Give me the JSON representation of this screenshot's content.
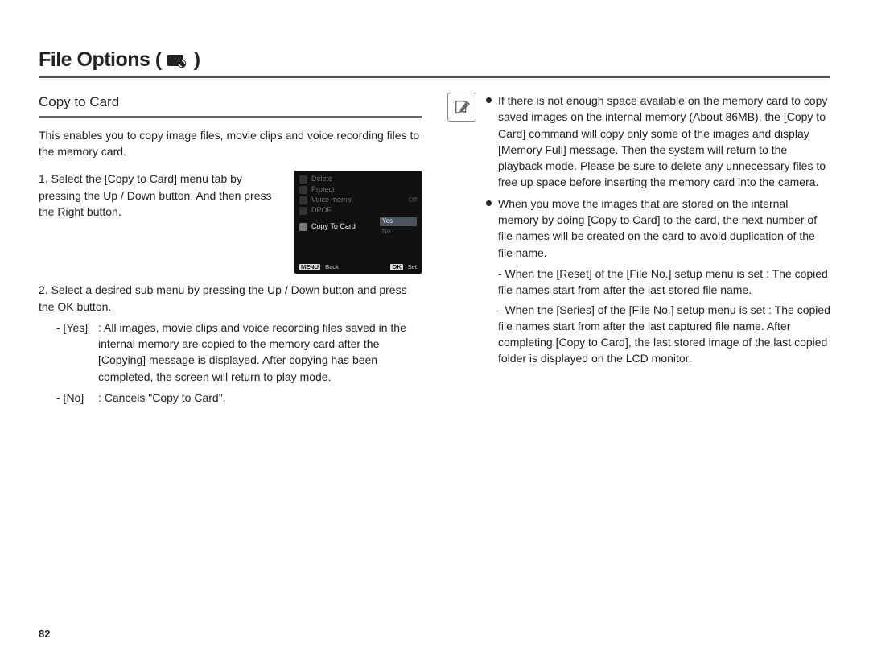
{
  "page_number": "82",
  "title": {
    "text": "File Options",
    "open_paren": "(",
    "close_paren": ")"
  },
  "left": {
    "subhead": "Copy to Card",
    "intro": "This enables you to copy image files, movie clips and voice recording files to the memory card.",
    "steps": [
      "1. Select the [Copy to Card] menu tab by pressing the Up / Down button. And then press the Right button.",
      "2. Select a desired sub menu by pressing the Up / Down button and press the OK button."
    ],
    "sub": [
      {
        "k": "- [Yes]",
        "v": ": All images, movie clips and voice recording files saved in the internal memory are copied to the memory card after the [Copying] message is displayed. After copying has been completed, the screen will return to play mode."
      },
      {
        "k": "- [No]",
        "v": ": Cancels \"Copy to Card\"."
      }
    ]
  },
  "cam": {
    "items": [
      "Delete",
      "Protect",
      "Voice memo",
      "DPOF",
      "Copy To Card"
    ],
    "off_label": "Off",
    "yn": {
      "yes": "Yes",
      "no": "No"
    },
    "foot": {
      "menu": "MENU",
      "back": "Back",
      "ok": "OK",
      "set": "Set"
    }
  },
  "right": {
    "notes": [
      "If there is not enough space available on the memory card to copy saved images on the internal memory (About 86MB), the [Copy to Card] command will copy only some of the images and display [Memory Full] message. Then the system will return to the playback mode. Please be sure to delete any unnecessary files to free up space before inserting the memory card into the camera.",
      "When you move the images that are stored on the internal memory by doing [Copy to Card] to the card, the next number of file names will be created on the card to avoid duplication of the file name."
    ],
    "subnotes": [
      "- When the [Reset] of the [File No.] setup menu is set : The copied file names start from after the last stored file name.",
      "- When the [Series] of the [File No.] setup menu is set : The copied file names start from after the last captured file name. After completing [Copy to Card], the last stored image of the last copied folder is displayed on the LCD monitor."
    ]
  }
}
